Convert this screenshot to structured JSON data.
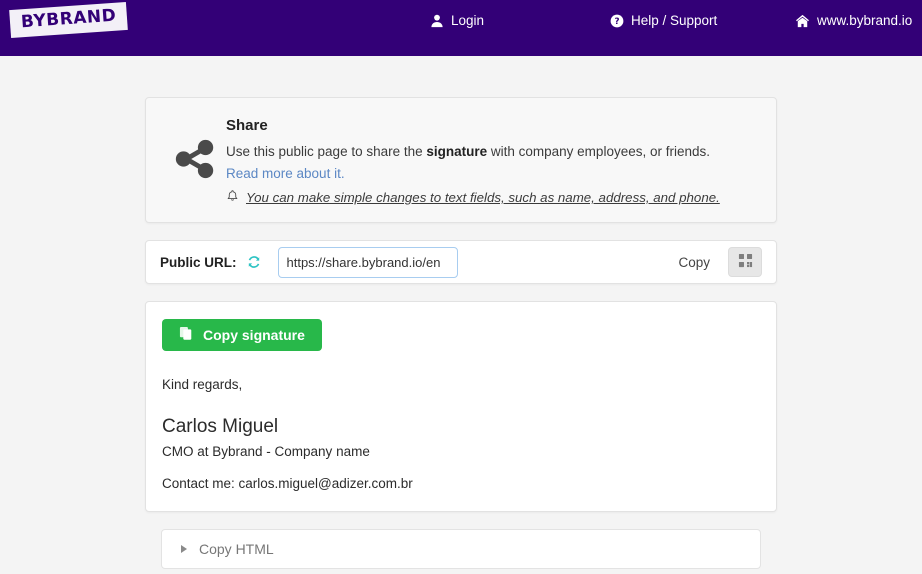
{
  "header": {
    "logo_text": "BYBRAND",
    "nav": [
      {
        "label": "Login",
        "icon": "user-icon"
      },
      {
        "label": "Help / Support",
        "icon": "question-circle-icon"
      },
      {
        "label": "www.bybrand.io",
        "icon": "home-icon"
      }
    ]
  },
  "share_card": {
    "icon": "share-nodes-icon",
    "title": "Share",
    "description_prefix": "Use this public page to share the ",
    "description_bold": "signature",
    "description_suffix": " with company employees, or friends.",
    "read_more_label": "Read more about it.",
    "notice_icon": "bell-icon",
    "notice_text": "You can make simple changes to text fields, such as name, address, and phone."
  },
  "url_row": {
    "label": "Public URL:",
    "refresh_icon": "refresh-icon",
    "url_value": "https://share.bybrand.io/en",
    "url_placeholder": "https://share.bybrand.io/",
    "copy_label": "Copy",
    "qr_icon": "qr-code-icon"
  },
  "signature_card": {
    "copy_button_label": "Copy signature",
    "copy_button_icon": "copy-icon",
    "greeting": "Kind regards,",
    "name": "Carlos Miguel",
    "role": "CMO at Bybrand  - Company name",
    "contact": "Contact me: carlos.miguel@adizer.com.br"
  },
  "accordion": {
    "label": "Copy HTML",
    "caret_icon": "caret-right-icon"
  },
  "colors": {
    "brand_purple": "#330077",
    "accent_green": "#28b84a",
    "link_blue": "#5b87c4",
    "refresh_teal": "#2ec4c4",
    "page_bg": "#f4f4f4"
  }
}
